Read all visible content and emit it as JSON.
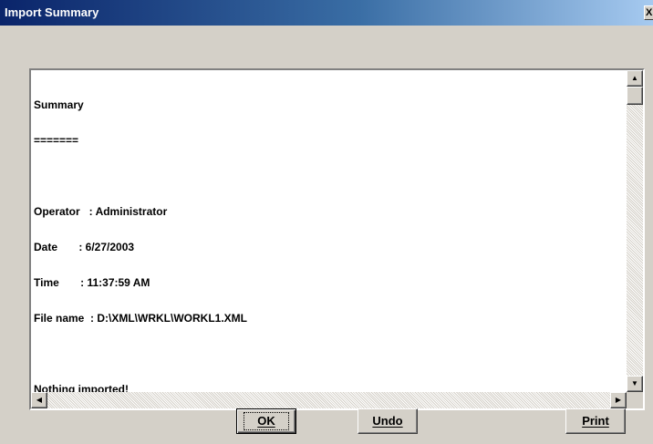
{
  "window": {
    "title": "Import Summary",
    "close_glyph": "X"
  },
  "summary": {
    "lines": [
      "Summary",
      "=======",
      "",
      "Operator   : Administrator",
      "Date       : 6/27/2003",
      "Time       : 11:37:59 AM",
      "File name  : D:\\XML\\WRKL\\WORKL1.XML",
      "",
      "Nothing imported!"
    ]
  },
  "scrollbars": {
    "up_icon": "arrow-up-icon",
    "down_icon": "arrow-down-icon",
    "left_icon": "arrow-left-icon",
    "right_icon": "arrow-right-icon"
  },
  "buttons": {
    "ok": "OK",
    "undo": "Undo",
    "print": "Print"
  }
}
